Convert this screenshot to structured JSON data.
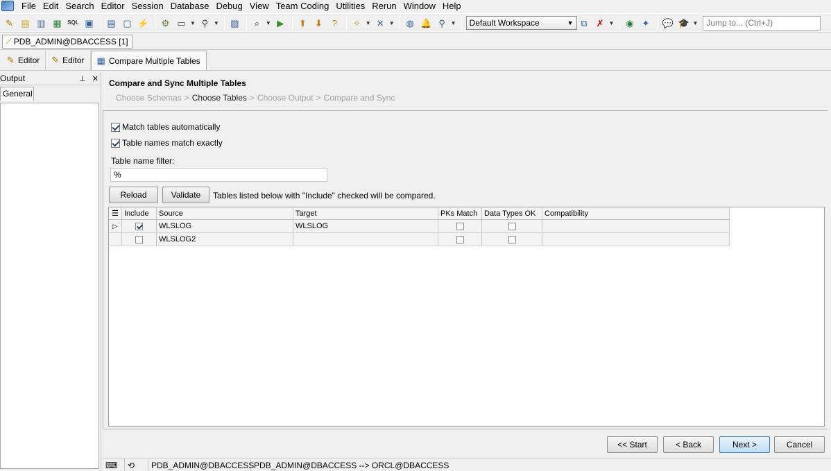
{
  "menu": [
    {
      "label": "File"
    },
    {
      "label": "Edit"
    },
    {
      "label": "Search"
    },
    {
      "label": "Editor"
    },
    {
      "label": "Session"
    },
    {
      "label": "Database"
    },
    {
      "label": "Debug"
    },
    {
      "label": "View"
    },
    {
      "label": "Team Coding"
    },
    {
      "label": "Utilities"
    },
    {
      "label": "Rerun"
    },
    {
      "label": "Window"
    },
    {
      "label": "Help"
    }
  ],
  "toolbar": {
    "workspace": "Default Workspace",
    "jump_placeholder": "Jump to... (Ctrl+J)"
  },
  "connection_tab": "PDB_ADMIN@DBACCESS [1]",
  "editor_tabs": [
    {
      "label": "Editor",
      "icon": "pencil-icon"
    },
    {
      "label": "Editor",
      "icon": "pencil-icon"
    },
    {
      "label": "Compare Multiple Tables",
      "icon": "table-compare-icon"
    }
  ],
  "output": {
    "title": "Output",
    "tab": "General"
  },
  "wizard": {
    "title": "Compare and Sync Multiple Tables",
    "steps": [
      {
        "label": "Choose Schemas"
      },
      {
        "label": "Choose Tables"
      },
      {
        "label": "Choose Output"
      },
      {
        "label": "Compare and Sync"
      }
    ],
    "separator": ">",
    "match_auto_label": "Match tables automatically",
    "match_exact_label": "Table names match exactly",
    "filter_label": "Table name filter:",
    "filter_value": "%",
    "reload_label": "Reload",
    "validate_label": "Validate",
    "hint": "Tables listed below with \"Include\" checked will be compared."
  },
  "grid": {
    "columns": [
      "Include",
      "Source",
      "Target",
      "PKs Match",
      "Data Types OK",
      "Compatibility"
    ],
    "rows": [
      {
        "include": true,
        "source": "WLSLOG",
        "target": "WLSLOG",
        "pks_match": false,
        "data_types_ok": false,
        "compatibility": ""
      },
      {
        "include": false,
        "source": "WLSLOG2",
        "target": "",
        "pks_match": false,
        "data_types_ok": false,
        "compatibility": ""
      }
    ]
  },
  "buttons": {
    "start": "<< Start",
    "back": "< Back",
    "next": "Next >",
    "cancel": "Cancel"
  },
  "statusbar": {
    "conn": "PDB_ADMIN@DBACCESS",
    "compare": "PDB_ADMIN@DBACCESS --> ORCL@DBACCESS"
  }
}
